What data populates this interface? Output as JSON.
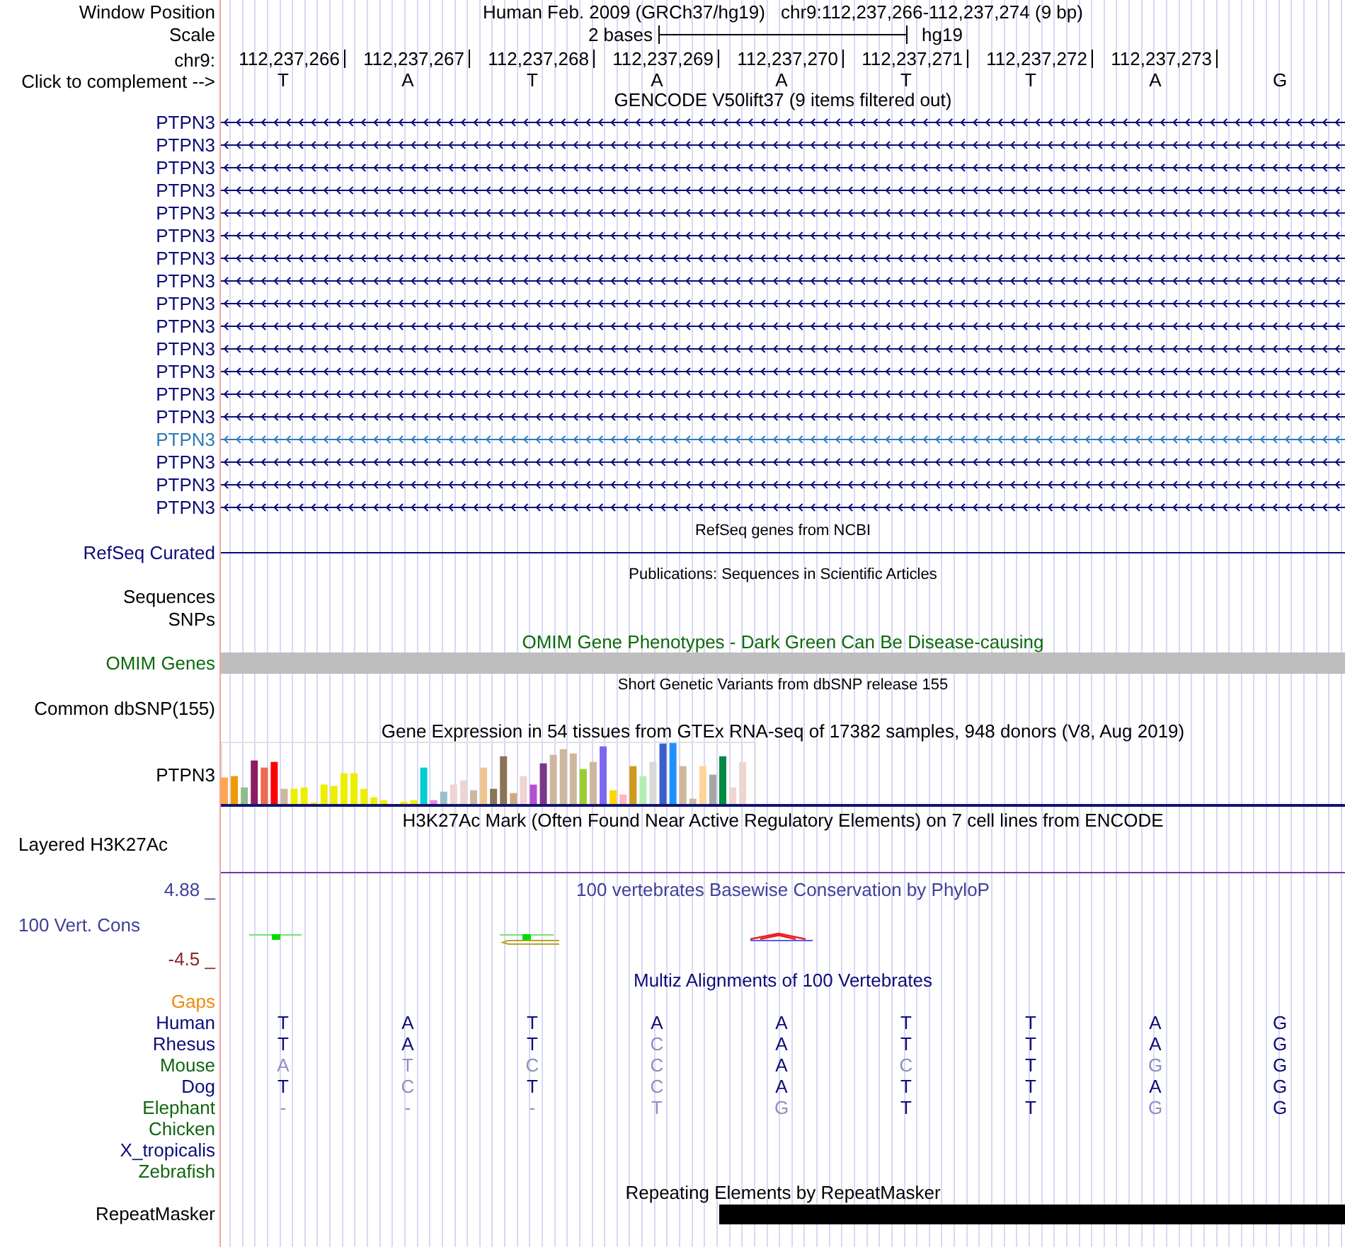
{
  "header": {
    "label": "Window Position",
    "assembly": "Human Feb. 2009 (GRCh37/hg19)",
    "position": "chr9:112,237,266-112,237,274 (9 bp)"
  },
  "scale": {
    "label": "Scale",
    "length": "2 bases",
    "assembly": "hg19"
  },
  "ruler": {
    "label": "chr9:",
    "positions": [
      "112,237,266",
      "112,237,267",
      "112,237,268",
      "112,237,269",
      "112,237,270",
      "112,237,271",
      "112,237,272",
      "112,237,273"
    ]
  },
  "sequence": {
    "label": "Click to complement -->",
    "bases": [
      "T",
      "A",
      "T",
      "A",
      "A",
      "T",
      "T",
      "A",
      "G"
    ]
  },
  "gencode": {
    "title": "GENCODE V50lift37 (9 items filtered out)",
    "genes": [
      {
        "name": "PTPN3",
        "color": "#0c0c78"
      },
      {
        "name": "PTPN3",
        "color": "#0c0c78"
      },
      {
        "name": "PTPN3",
        "color": "#0c0c78"
      },
      {
        "name": "PTPN3",
        "color": "#0c0c78"
      },
      {
        "name": "PTPN3",
        "color": "#0c0c78"
      },
      {
        "name": "PTPN3",
        "color": "#0c0c78"
      },
      {
        "name": "PTPN3",
        "color": "#0c0c78"
      },
      {
        "name": "PTPN3",
        "color": "#0c0c78"
      },
      {
        "name": "PTPN3",
        "color": "#0c0c78"
      },
      {
        "name": "PTPN3",
        "color": "#0c0c78"
      },
      {
        "name": "PTPN3",
        "color": "#0c0c78"
      },
      {
        "name": "PTPN3",
        "color": "#0c0c78"
      },
      {
        "name": "PTPN3",
        "color": "#0c0c78"
      },
      {
        "name": "PTPN3",
        "color": "#0c0c78"
      },
      {
        "name": "PTPN3",
        "color": "#2f7ab6"
      },
      {
        "name": "PTPN3",
        "color": "#0c0c78"
      },
      {
        "name": "PTPN3",
        "color": "#0c0c78"
      },
      {
        "name": "PTPN3",
        "color": "#0c0c78"
      }
    ]
  },
  "refseq": {
    "title": "RefSeq genes from NCBI",
    "label": "RefSeq Curated"
  },
  "publications": {
    "title": "Publications: Sequences in Scientific Articles",
    "labels": [
      "Sequences",
      "SNPs"
    ]
  },
  "omim": {
    "title": "OMIM Gene Phenotypes - Dark Green Can Be Disease-causing",
    "label": "OMIM Genes"
  },
  "dbsnp": {
    "title": "Short Genetic Variants from dbSNP release 155",
    "label": "Common dbSNP(155)"
  },
  "gtex": {
    "title": "Gene Expression in 54 tissues from GTEx RNA-seq of 17382 samples, 948 donors (V8, Aug 2019)",
    "label": "PTPN3"
  },
  "h3k27ac": {
    "title": "H3K27Ac Mark (Often Found Near Active Regulatory Elements) on 7 cell lines from ENCODE",
    "label": "Layered H3K27Ac"
  },
  "phylop": {
    "title": "100 vertebrates Basewise Conservation by PhyloP",
    "label": "100 Vert. Cons",
    "axis_max": "4.88 _",
    "axis_min": "-4.5 _"
  },
  "multiz": {
    "title": "Multiz Alignments of 100 Vertebrates",
    "gaps_label": "Gaps",
    "species": [
      {
        "name": "Human",
        "color": "#0c0c78",
        "bases": [
          {
            "letter": "T",
            "matches": true
          },
          {
            "letter": "A",
            "matches": true
          },
          {
            "letter": "T",
            "matches": true
          },
          {
            "letter": "A",
            "matches": true
          },
          {
            "letter": "A",
            "matches": true
          },
          {
            "letter": "T",
            "matches": true
          },
          {
            "letter": "T",
            "matches": true
          },
          {
            "letter": "A",
            "matches": true
          },
          {
            "letter": "G",
            "matches": true
          }
        ]
      },
      {
        "name": "Rhesus",
        "color": "#0c0c78",
        "bases": [
          {
            "letter": "T",
            "matches": true
          },
          {
            "letter": "A",
            "matches": true
          },
          {
            "letter": "T",
            "matches": true
          },
          {
            "letter": "C",
            "matches": false
          },
          {
            "letter": "A",
            "matches": true
          },
          {
            "letter": "T",
            "matches": true
          },
          {
            "letter": "T",
            "matches": true
          },
          {
            "letter": "A",
            "matches": true
          },
          {
            "letter": "G",
            "matches": true
          }
        ]
      },
      {
        "name": "Mouse",
        "color": "#106610",
        "bases": [
          {
            "letter": "A",
            "matches": false
          },
          {
            "letter": "T",
            "matches": false
          },
          {
            "letter": "C",
            "matches": false
          },
          {
            "letter": "C",
            "matches": false
          },
          {
            "letter": "A",
            "matches": true
          },
          {
            "letter": "C",
            "matches": false
          },
          {
            "letter": "T",
            "matches": true
          },
          {
            "letter": "G",
            "matches": false
          },
          {
            "letter": "G",
            "matches": true
          }
        ]
      },
      {
        "name": "Dog",
        "color": "#0c0c78",
        "bases": [
          {
            "letter": "T",
            "matches": true
          },
          {
            "letter": "C",
            "matches": false
          },
          {
            "letter": "T",
            "matches": true
          },
          {
            "letter": "C",
            "matches": false
          },
          {
            "letter": "A",
            "matches": true
          },
          {
            "letter": "T",
            "matches": true
          },
          {
            "letter": "T",
            "matches": true
          },
          {
            "letter": "A",
            "matches": true
          },
          {
            "letter": "G",
            "matches": true
          }
        ]
      },
      {
        "name": "Elephant",
        "color": "#106610",
        "bases": [
          {
            "letter": "-",
            "matches": false
          },
          {
            "letter": "-",
            "matches": false
          },
          {
            "letter": "-",
            "matches": false
          },
          {
            "letter": "T",
            "matches": false
          },
          {
            "letter": "G",
            "matches": false
          },
          {
            "letter": "T",
            "matches": true
          },
          {
            "letter": "T",
            "matches": true
          },
          {
            "letter": "G",
            "matches": false
          },
          {
            "letter": "G",
            "matches": true
          }
        ]
      },
      {
        "name": "Chicken",
        "color": "#106610"
      },
      {
        "name": "X_tropicalis",
        "color": "#0c0c78"
      },
      {
        "name": "Zebrafish",
        "color": "#106610"
      }
    ]
  },
  "repeatmasker": {
    "title": "Repeating Elements by RepeatMasker",
    "label": "RepeatMasker"
  }
}
